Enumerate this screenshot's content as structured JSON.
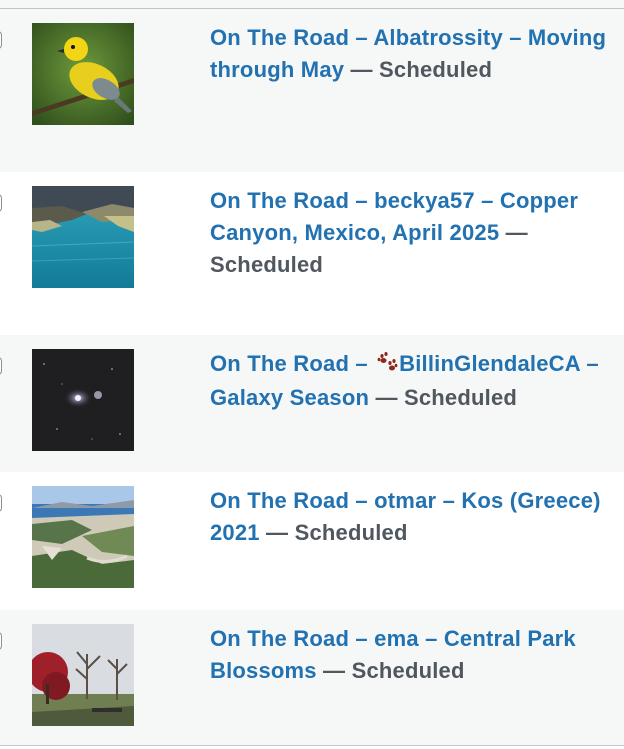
{
  "posts": [
    {
      "title": "On The Road – Albatrossity – Moving through May",
      "separator": " — ",
      "status": "Scheduled",
      "thumbnail": "yellow-bird-on-branch"
    },
    {
      "title": "On The Road – beckya57 – Copper Canyon, Mexico, April 2025",
      "separator": " — ",
      "status": "Scheduled",
      "thumbnail": "turquoise-water-and-rocks"
    },
    {
      "title_prefix": "On The Road – ",
      "title_suffix": "BillinGlendaleCA – Galaxy Season",
      "emoji_icon": "paw-prints-icon",
      "separator": " — ",
      "status": "Scheduled",
      "thumbnail": "spiral-galaxy"
    },
    {
      "title": "On The Road – otmar – Kos (Greece) 2021",
      "separator": " — ",
      "status": "Scheduled",
      "thumbnail": "coastal-hillside"
    },
    {
      "title": "On The Road – ema – Central Park Blossoms",
      "separator": " — ",
      "status": "Scheduled",
      "thumbnail": "park-with-red-tree"
    }
  ],
  "colors": {
    "link": "#2271b1",
    "status": "#50575e",
    "row_alt": "#f6f7f7",
    "row_plain": "#ffffff",
    "paw": "#8a2b1e"
  }
}
